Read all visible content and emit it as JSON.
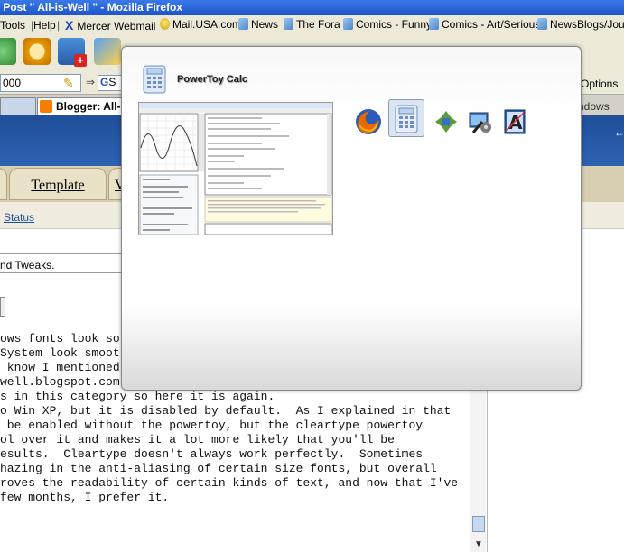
{
  "window_title": "t Post \" All-is-Well \" - Mozilla Firefox",
  "menu": {
    "tools": "Tools",
    "help": "Help"
  },
  "bookmarks": [
    {
      "label": "Mercer Webmail"
    },
    {
      "label": "Mail.USA.com"
    },
    {
      "label": "News"
    },
    {
      "label": "The Fora"
    },
    {
      "label": "Comics - Funny"
    },
    {
      "label": "Comics - Art/Serious"
    },
    {
      "label": "NewsBlogs/Journ"
    }
  ],
  "address_value": "000",
  "search_prefix": "S",
  "options_label": "Options",
  "tab_label": "Blogger: All-i",
  "right_tab_partial": "ndows XP",
  "template_tab": "Template",
  "next_tab_partial": "V",
  "status_link": "Status",
  "tweaks_text": "nd Tweaks.",
  "editor_lines": [
    "ows fonts look so",
    "System look smoot",
    " know I mentioned",
    "well.blogspot.com",
    "s in this category so here it is again.",
    "",
    "o Win XP, but it is disabled by default.  As I explained in that",
    " be enabled without the powertoy, but the cleartype powertoy",
    "ol over it and makes it a lot more likely that you'll be",
    "esults.  Cleartype doesn't always work perfectly.  Sometimes",
    "hazing in the anti-aliasing of certain size fonts, but overall",
    "roves the readability of certain kinds of text, and now that I've",
    "few months, I prefer it."
  ],
  "overlay": {
    "title": "PowerToy Calc",
    "selected_icon": "calculator-icon",
    "icons": [
      "firefox-icon",
      "calculator-icon",
      "network-icon",
      "control-panel-icon",
      "font-icon"
    ]
  },
  "colors": {
    "titlebar": "#2a63d6",
    "banner": "#2a5ba8",
    "tan": "#d8cfb3",
    "link": "#1e4f9a"
  }
}
